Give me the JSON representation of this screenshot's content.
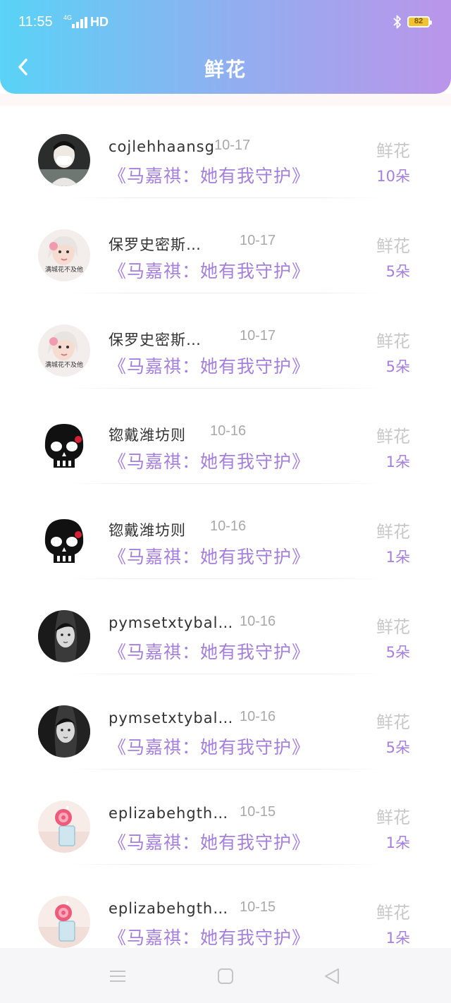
{
  "status_bar": {
    "time": "11:55",
    "network": "4G",
    "hd": "HD",
    "battery": "82"
  },
  "header": {
    "title": "鲜花"
  },
  "items": [
    {
      "user": "cojlehhaansg",
      "date": "10-17",
      "title": "《马嘉祺：她有我守护》",
      "gift": "鲜花",
      "count": "10朵",
      "avatar": "avatar-masked-boy",
      "avatar_text": ""
    },
    {
      "user": "保罗史密斯…",
      "date": "10-17",
      "title": "《马嘉祺：她有我守护》",
      "gift": "鲜花",
      "count": "5朵",
      "avatar": "avatar-girl-flower",
      "avatar_text": "满城花不及他"
    },
    {
      "user": "保罗史密斯…",
      "date": "10-17",
      "title": "《马嘉祺：她有我守护》",
      "gift": "鲜花",
      "count": "5朵",
      "avatar": "avatar-girl-flower",
      "avatar_text": "满城花不及他"
    },
    {
      "user": "锪戴潍坊则",
      "date": "10-16",
      "title": "《马嘉祺：她有我守护》",
      "gift": "鲜花",
      "count": "1朵",
      "avatar": "avatar-skull",
      "avatar_text": ""
    },
    {
      "user": "锪戴潍坊则",
      "date": "10-16",
      "title": "《马嘉祺：她有我守护》",
      "gift": "鲜花",
      "count": "1朵",
      "avatar": "avatar-skull",
      "avatar_text": ""
    },
    {
      "user": "pymsetxtybal…",
      "date": "10-16",
      "title": "《马嘉祺：她有我守护》",
      "gift": "鲜花",
      "count": "5朵",
      "avatar": "avatar-bw-girl",
      "avatar_text": ""
    },
    {
      "user": "pymsetxtybal…",
      "date": "10-16",
      "title": "《马嘉祺：她有我守护》",
      "gift": "鲜花",
      "count": "5朵",
      "avatar": "avatar-bw-girl",
      "avatar_text": ""
    },
    {
      "user": "eplizabehgth…",
      "date": "10-15",
      "title": "《马嘉祺：她有我守护》",
      "gift": "鲜花",
      "count": "1朵",
      "avatar": "avatar-lollipop",
      "avatar_text": ""
    },
    {
      "user": "eplizabehgth…",
      "date": "10-15",
      "title": "《马嘉祺：她有我守护》",
      "gift": "鲜花",
      "count": "1朵",
      "avatar": "avatar-lollipop",
      "avatar_text": ""
    }
  ],
  "navbar": {
    "icons": [
      "menu-icon",
      "home-square-icon",
      "back-triangle-icon"
    ]
  }
}
